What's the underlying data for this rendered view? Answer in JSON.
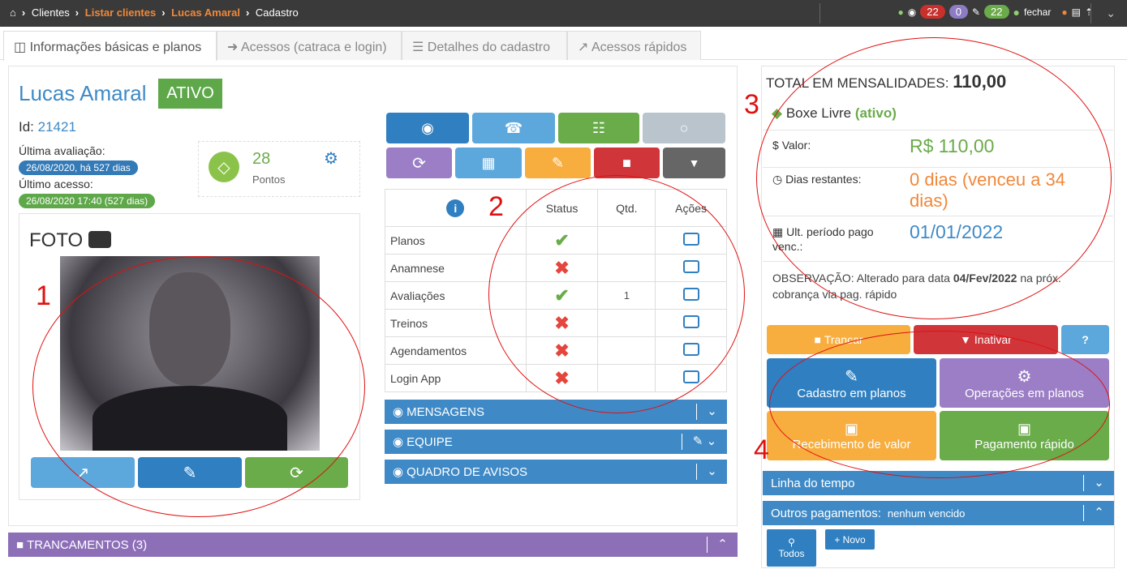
{
  "breadcrumb": {
    "home": "Clientes",
    "list": "Listar clientes",
    "client": "Lucas Amaral",
    "page": "Cadastro"
  },
  "topbar": {
    "badge1": "22",
    "badge2": "0",
    "badge3": "22",
    "close": "fechar"
  },
  "tabs": [
    {
      "label": "Informações básicas e planos"
    },
    {
      "label": "Acessos (catraca e login)"
    },
    {
      "label": "Detalhes do cadastro"
    },
    {
      "label": "Acessos rápidos"
    }
  ],
  "client": {
    "name": "Lucas Amaral",
    "status": "ATIVO",
    "id_label": "Id:",
    "id": "21421",
    "last_eval_label": "Última avaliação:",
    "last_eval": "26/08/2020, há 527 dias",
    "last_access_label": "Último acesso:",
    "last_access": "26/08/2020 17:40 (527 dias)",
    "points": "28",
    "points_label": "Pontos",
    "photo_label": "FOTO"
  },
  "status_table": {
    "headers": [
      "Status",
      "Qtd."
    ],
    "actions": "Ações",
    "rows": [
      {
        "name": "Planos",
        "ok": true,
        "qtd": ""
      },
      {
        "name": "Anamnese",
        "ok": false,
        "qtd": ""
      },
      {
        "name": "Avaliações",
        "ok": true,
        "qtd": "1"
      },
      {
        "name": "Treinos",
        "ok": false,
        "qtd": ""
      },
      {
        "name": "Agendamentos",
        "ok": false,
        "qtd": ""
      },
      {
        "name": "Login App",
        "ok": false,
        "qtd": ""
      }
    ]
  },
  "bars": {
    "messages": "MENSAGENS",
    "team": "EQUIPE",
    "board": "QUADRO DE AVISOS",
    "lockings": "TRANCAMENTOS (3)"
  },
  "plan": {
    "total_label": "TOTAL EM MENSALIDADES:",
    "total": "110,00",
    "name": "Boxe Livre",
    "state": "(ativo)",
    "value_label": "Valor:",
    "value": "R$ 110,00",
    "days_label": "Dias restantes:",
    "days": "0 dias (venceu a 34 dias)",
    "last_label": "Ult. período pago venc.:",
    "last": "01/01/2022",
    "obs_pre": "OBSERVAÇÃO: Alterado para data ",
    "obs_date": "04/Fev/2022",
    "obs_post": " na próx. cobrança via pag. rápido"
  },
  "plan_buttons": {
    "lock": "Trancar",
    "inactivate": "Inativar",
    "help": "?",
    "register": "Cadastro em planos",
    "operations": "Operações em planos",
    "receive": "Recebimento de valor",
    "quickpay": "Pagamento rápido"
  },
  "timeline": {
    "label": "Linha do tempo"
  },
  "other_payments": {
    "label": "Outros pagamentos:",
    "status": "nenhum vencido",
    "all": "Todos",
    "new": "Novo"
  },
  "annotations": [
    "1",
    "2",
    "3",
    "4"
  ]
}
